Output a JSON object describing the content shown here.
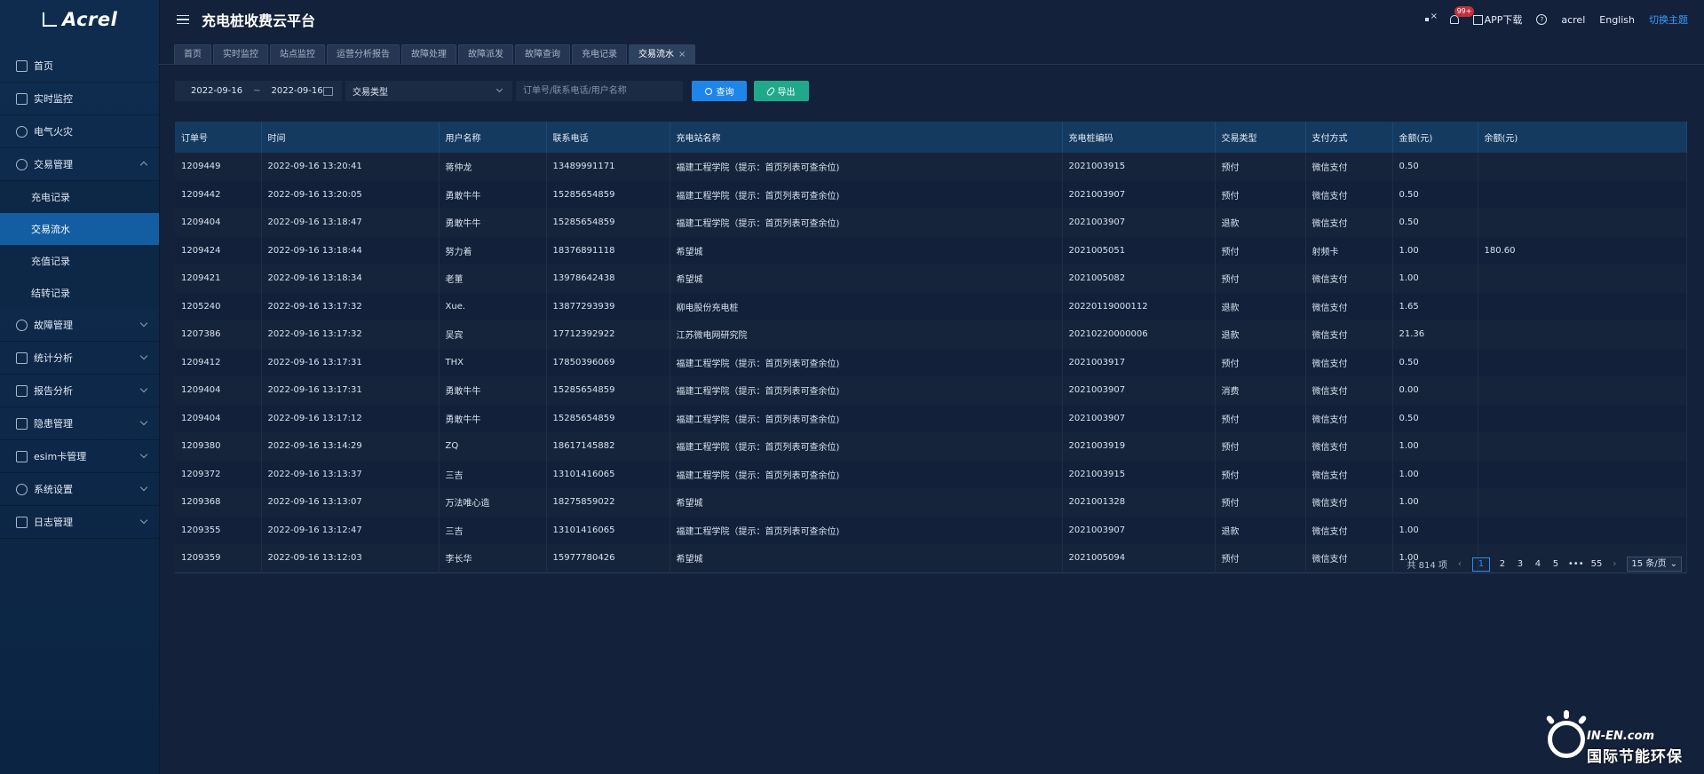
{
  "logo": {
    "text": "Acrel"
  },
  "header": {
    "title": "充电桩收费云平台",
    "badge": "99+",
    "app_download": "APP下载",
    "user": "acrel",
    "language": "English",
    "theme": "切换主题"
  },
  "sidebar": {
    "items": [
      {
        "label": "首页",
        "icon": "monitor-icon"
      },
      {
        "label": "实时监控",
        "icon": "pulse-icon"
      },
      {
        "label": "电气火灾",
        "icon": "fire-icon"
      },
      {
        "label": "交易管理",
        "icon": "transaction-icon",
        "expanded": true
      },
      {
        "label": "故障管理",
        "icon": "fault-icon"
      },
      {
        "label": "统计分析",
        "icon": "bar-chart-icon"
      },
      {
        "label": "报告分析",
        "icon": "report-icon"
      },
      {
        "label": "隐患管理",
        "icon": "warning-icon"
      },
      {
        "label": "esim卡管理",
        "icon": "sim-card-icon"
      },
      {
        "label": "系统设置",
        "icon": "settings-icon"
      },
      {
        "label": "日志管理",
        "icon": "log-icon"
      }
    ],
    "subitems": [
      "充电记录",
      "交易流水",
      "充值记录",
      "结转记录"
    ]
  },
  "tabs": [
    "首页",
    "实时监控",
    "站点监控",
    "运营分析报告",
    "故障处理",
    "故障派发",
    "故障查询",
    "充电记录",
    "交易流水"
  ],
  "filters": {
    "date_start": "2022-09-16",
    "date_sep": "~",
    "date_end": "2022-09-16",
    "type_select": "交易类型",
    "search_placeholder": "订单号/联系电话/用户名称",
    "query_label": "查询",
    "export_label": "导出"
  },
  "table": {
    "columns": [
      "订单号",
      "时间",
      "用户名称",
      "联系电话",
      "充电站名称",
      "充电桩编码",
      "交易类型",
      "支付方式",
      "金额(元)",
      "余额(元)"
    ],
    "rows": [
      [
        "1209449",
        "2022-09-16 13:20:41",
        "蒋仲龙",
        "13489991171",
        "福建工程学院（提示：首页列表可查余位)",
        "2021003915",
        "预付",
        "微信支付",
        "0.50",
        ""
      ],
      [
        "1209442",
        "2022-09-16 13:20:05",
        "勇敢牛牛",
        "15285654859",
        "福建工程学院（提示：首页列表可查余位)",
        "2021003907",
        "预付",
        "微信支付",
        "0.50",
        ""
      ],
      [
        "1209404",
        "2022-09-16 13:18:47",
        "勇敢牛牛",
        "15285654859",
        "福建工程学院（提示：首页列表可查余位)",
        "2021003907",
        "退款",
        "微信支付",
        "0.50",
        ""
      ],
      [
        "1209424",
        "2022-09-16 13:18:44",
        "努力着",
        "18376891118",
        "希望城",
        "2021005051",
        "预付",
        "射频卡",
        "1.00",
        "180.60"
      ],
      [
        "1209421",
        "2022-09-16 13:18:34",
        "老董",
        "13978642438",
        "希望城",
        "2021005082",
        "预付",
        "微信支付",
        "1.00",
        ""
      ],
      [
        "1205240",
        "2022-09-16 13:17:32",
        "Xue.",
        "13877293939",
        "柳电股份充电桩",
        "20220119000112",
        "退款",
        "微信支付",
        "1.65",
        ""
      ],
      [
        "1207386",
        "2022-09-16 13:17:32",
        "吴宾",
        "17712392922",
        "江苏微电网研究院",
        "20210220000006",
        "退款",
        "微信支付",
        "21.36",
        ""
      ],
      [
        "1209412",
        "2022-09-16 13:17:31",
        "THX",
        "17850396069",
        "福建工程学院（提示：首页列表可查余位)",
        "2021003917",
        "预付",
        "微信支付",
        "0.50",
        ""
      ],
      [
        "1209404",
        "2022-09-16 13:17:31",
        "勇敢牛牛",
        "15285654859",
        "福建工程学院（提示：首页列表可查余位)",
        "2021003907",
        "消费",
        "微信支付",
        "0.00",
        ""
      ],
      [
        "1209404",
        "2022-09-16 13:17:12",
        "勇敢牛牛",
        "15285654859",
        "福建工程学院（提示：首页列表可查余位)",
        "2021003907",
        "预付",
        "微信支付",
        "0.50",
        ""
      ],
      [
        "1209380",
        "2022-09-16 13:14:29",
        "ZQ",
        "18617145882",
        "福建工程学院（提示：首页列表可查余位)",
        "2021003919",
        "预付",
        "微信支付",
        "1.00",
        ""
      ],
      [
        "1209372",
        "2022-09-16 13:13:37",
        "三吉",
        "13101416065",
        "福建工程学院（提示：首页列表可查余位)",
        "2021003915",
        "预付",
        "微信支付",
        "1.00",
        ""
      ],
      [
        "1209368",
        "2022-09-16 13:13:07",
        "万法唯心造",
        "18275859022",
        "希望城",
        "2021001328",
        "预付",
        "微信支付",
        "1.00",
        ""
      ],
      [
        "1209355",
        "2022-09-16 13:12:47",
        "三吉",
        "13101416065",
        "福建工程学院（提示：首页列表可查余位)",
        "2021003907",
        "退款",
        "微信支付",
        "1.00",
        ""
      ],
      [
        "1209359",
        "2022-09-16 13:12:03",
        "李长华",
        "15977780426",
        "希望城",
        "2021005094",
        "预付",
        "微信支付",
        "1.00",
        ""
      ]
    ]
  },
  "pagination": {
    "total": "共 814 项",
    "pages": [
      "1",
      "2",
      "3",
      "4",
      "5"
    ],
    "ellipsis": "•••",
    "last": "55",
    "page_size": "15 条/页"
  },
  "watermark": {
    "line1": "IN-EN.com",
    "line2": "国际节能环保"
  },
  "colors": {
    "accent": "#1e86e8",
    "export": "#20a88a",
    "active_menu": "#135ea2",
    "theme_link": "#3a9cff"
  }
}
